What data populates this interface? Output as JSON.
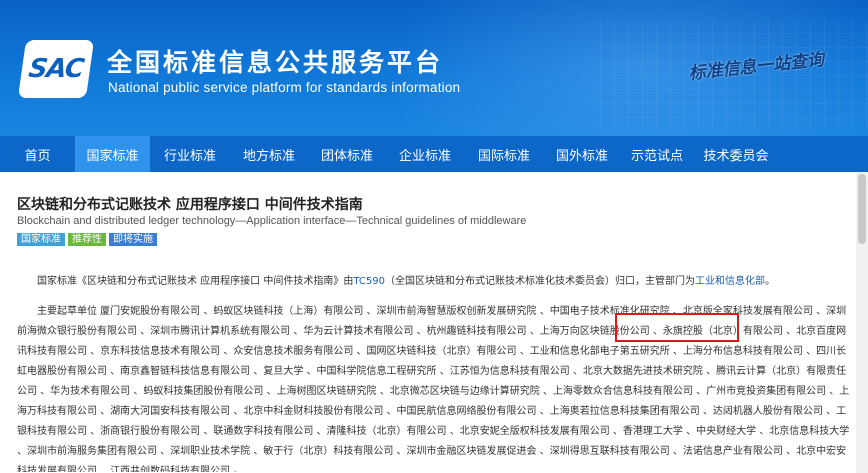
{
  "header": {
    "logo_text": "SAC",
    "title_cn": "全国标准信息公共服务平台",
    "title_en": "National public service platform  for standards information",
    "slogan": "标准信息一站查询"
  },
  "nav": {
    "items": [
      {
        "label": "首页"
      },
      {
        "label": "国家标准"
      },
      {
        "label": "行业标准"
      },
      {
        "label": "地方标准"
      },
      {
        "label": "团体标准"
      },
      {
        "label": "企业标准"
      },
      {
        "label": "国际标准"
      },
      {
        "label": "国外标准"
      },
      {
        "label": "示范试点"
      },
      {
        "label": "技术委员会"
      }
    ],
    "active": "国家标准"
  },
  "standard": {
    "title_cn": "区块链和分布式记账技术 应用程序接口 中间件技术指南",
    "title_en": "Blockchain and distributed ledger technology—Application interface—Technical guidelines of middleware",
    "tags": [
      "国家标准",
      "推荐性",
      "即将实施"
    ],
    "p1_before": "国家标准《区块链和分布式记账技术 应用程序接口 中间件技术指南》由",
    "p1_link": "TC590",
    "p1_middle": "（全国区块链和分布式记账技术标准化技术委员会）归口，主管部门为",
    "p1_link2": "工业和信息化部",
    "p1_end": "。",
    "drafters": "主要起草单位 厦门安妮股份有限公司 、蚂蚁区块链科技（上海）有限公司 、深圳市前海智慧版权创新发展研究院 、中国电子技术标准化研究院 、北京版全家科技发展有限公司 、深圳前海微众银行股份有限公司 、深圳市腾讯计算机系统有限公司 、华为云计算技术有限公司 、杭州趣链科技有限公司 、上海万向区块链股份公司 、永旗控股（北京）有限公司 、北京百度网讯科技有限公司 、京东科技信息技术有限公司 、众安信息技术服务有限公司 、国网区块链科技（北京）有限公司 、工业和信息化部电子第五研究所 、上海分布信息科技有限公司 、四川长虹电器股份有限公司 、南京鑫智链科技信息有限公司 、复旦大学 、中国科学院信息工程研究所 、江苏恒为信息科技有限公司 、北京大数据先进技术研究院 、腾讯云计算（北京）有限责任公司 、华为技术有限公司 、蚂蚁科技集团股份有限公司 、上海树图区块链研究院 、北京微芯区块链与边缘计算研究院 、上海零数众合信息科技有限公司 、广州市竞投资集团有限公司 、上海万科技有限公司 、湖南大河国安科技有限公司 、北京中科金财科技股份有限公司 、中国民航信息网络股份有限公司 、上海奥若拉信息科技集团有限公司 、达闼机器人股份有限公司 、工银科技有限公司 、浙商银行股份有限公司 、联通数字科技有限公司 、清隆科技（北京）有限公司 、北京安妮全版权科技发展有限公司 、香港理工大学 、中央财经大学 、北京信息科技大学 、深圳市前海服务集团有限公司 、深圳职业技术学院 、敏于行（北京）科技有限公司 、深圳市金融区块链发展促进会 、深圳得思互联科技有限公司 、法诺信息产业有限公司 、北京中宏安科技发展有限公司 、江西井创数码科技有限公司 。"
  },
  "colors": {
    "header_blue": "#0f78d8",
    "nav_blue": "#0c67c9",
    "nav_active": "#2f93ee",
    "highlight_red": "#e0161b",
    "link_blue": "#1a5fb4"
  }
}
